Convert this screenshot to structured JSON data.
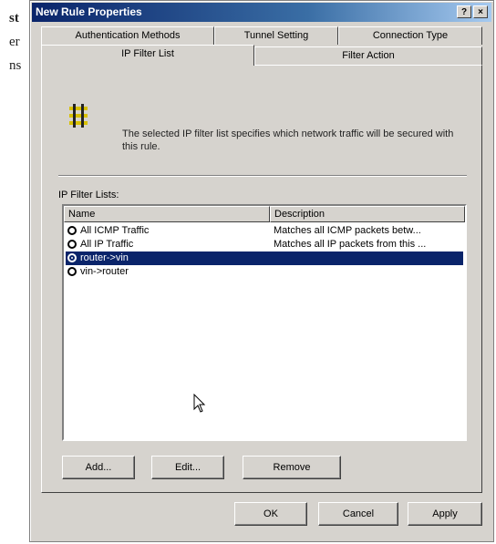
{
  "background_text": [
    "st",
    "er",
    "ns"
  ],
  "window": {
    "title": "New Rule Properties",
    "help_button": "?",
    "close_button": "×"
  },
  "tabs": {
    "back_row": [
      "Authentication Methods",
      "Tunnel Setting",
      "Connection Type"
    ],
    "front_row": [
      "IP Filter List",
      "Filter Action"
    ],
    "active": "IP Filter List"
  },
  "panel": {
    "description": "The selected IP filter list specifies which network traffic will be secured with this rule.",
    "list_label": "IP Filter Lists:",
    "columns": [
      "Name",
      "Description"
    ],
    "rows": [
      {
        "name": "All ICMP Traffic",
        "description": "Matches all ICMP packets betw...",
        "selected": false
      },
      {
        "name": "All IP Traffic",
        "description": "Matches all IP packets from this ...",
        "selected": false
      },
      {
        "name": "router->vin",
        "description": "",
        "selected": true
      },
      {
        "name": "vin->router",
        "description": "",
        "selected": false
      }
    ],
    "buttons": {
      "add": "Add...",
      "edit": "Edit...",
      "remove": "Remove"
    }
  },
  "footer_buttons": {
    "ok": "OK",
    "cancel": "Cancel",
    "apply": "Apply"
  },
  "colors": {
    "selection": "#0a246a",
    "dialog_bg": "#d6d3ce",
    "icon_yellow": "#d8c000"
  }
}
